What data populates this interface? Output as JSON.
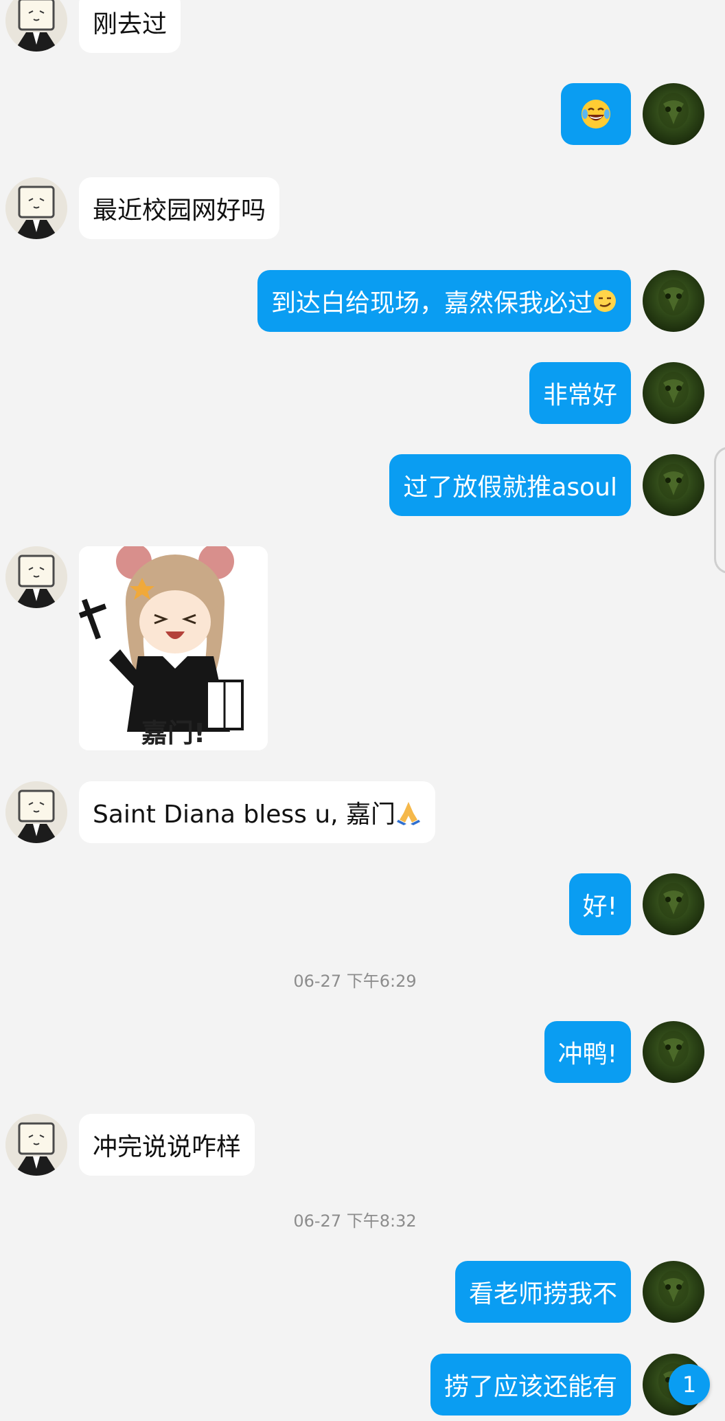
{
  "messages": [
    {
      "side": "left",
      "type": "text",
      "text": "刚去过"
    },
    {
      "side": "right",
      "type": "emoji",
      "emoji": "laughing-tears-icon"
    },
    {
      "side": "left",
      "type": "text",
      "text": "最近校园网好吗"
    },
    {
      "side": "right",
      "type": "text",
      "text": "到达白给现场，嘉然保我必过",
      "trailing_emoji": "smirk-face-icon"
    },
    {
      "side": "right",
      "type": "text",
      "text": "非常好"
    },
    {
      "side": "right",
      "type": "text",
      "text": "过了放假就推asoul"
    },
    {
      "side": "left",
      "type": "sticker",
      "caption": "嘉门!"
    },
    {
      "side": "left",
      "type": "text",
      "text": "Saint Diana bless u, 嘉门",
      "trailing_emoji": "praying-hands-icon"
    },
    {
      "side": "right",
      "type": "text",
      "text": "好!"
    },
    {
      "type": "timestamp",
      "text": "06-27 下午6:29"
    },
    {
      "side": "right",
      "type": "text",
      "text": "冲鸭!"
    },
    {
      "side": "left",
      "type": "text",
      "text": "冲完说说咋样"
    },
    {
      "type": "timestamp",
      "text": "06-27 下午8:32"
    },
    {
      "side": "right",
      "type": "text",
      "text": "看老师捞我不"
    },
    {
      "side": "right",
      "type": "text",
      "text": "捞了应该还能有"
    }
  ],
  "unread_badge": "1",
  "colors": {
    "background": "#f3f3f3",
    "incoming_bubble": "#ffffff",
    "outgoing_bubble": "#0a9df2",
    "timestamp": "#8c8c8c"
  }
}
